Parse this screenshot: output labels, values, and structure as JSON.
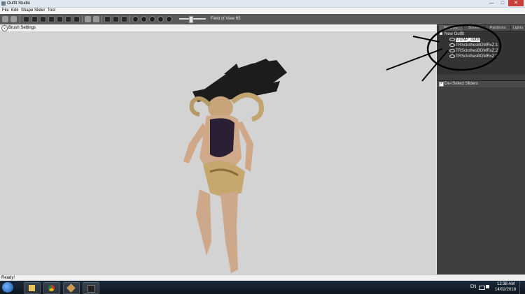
{
  "window": {
    "title": "Outfit Studio"
  },
  "menu": {
    "items": [
      "File",
      "Edit",
      "Shape",
      "Slider",
      "Tool"
    ]
  },
  "toolbar": {
    "fov_label": "Field of View 65"
  },
  "brush": {
    "label": "Brush Settings"
  },
  "panel": {
    "tabs": [
      "Meshes",
      "Bones",
      "Partitions",
      "Lights"
    ],
    "tree": {
      "root": "New Outfit",
      "items": [
        "UUNP_outfit",
        "TRSclothesBDMRxZ:1",
        "TRSclothesBDMRxZ:2",
        "TRSclothesBDMRxZ:3"
      ],
      "selected_index": 0
    },
    "slider_toggle": "De-/Select Sliders"
  },
  "status": {
    "text": "Ready!"
  },
  "taskbar": {
    "language": "EN",
    "time": "12:38 AM",
    "date": "14/02/2018"
  },
  "colors": {
    "viewport_bg": "#d3d3d3",
    "panel_bg": "#3e3e3e",
    "toolbar_bg": "#5a5a5a",
    "close_button": "#c7423a"
  },
  "icons": [
    "app-icon",
    "minimize-icon",
    "maximize-icon",
    "close-icon",
    "chevron-down-icon",
    "eye-icon",
    "checkbox-icon",
    "windows-start-icon",
    "file-explorer-icon",
    "chrome-icon",
    "outfit-studio-icon",
    "app-icon-dark",
    "keyboard-icon",
    "flag-icon"
  ]
}
